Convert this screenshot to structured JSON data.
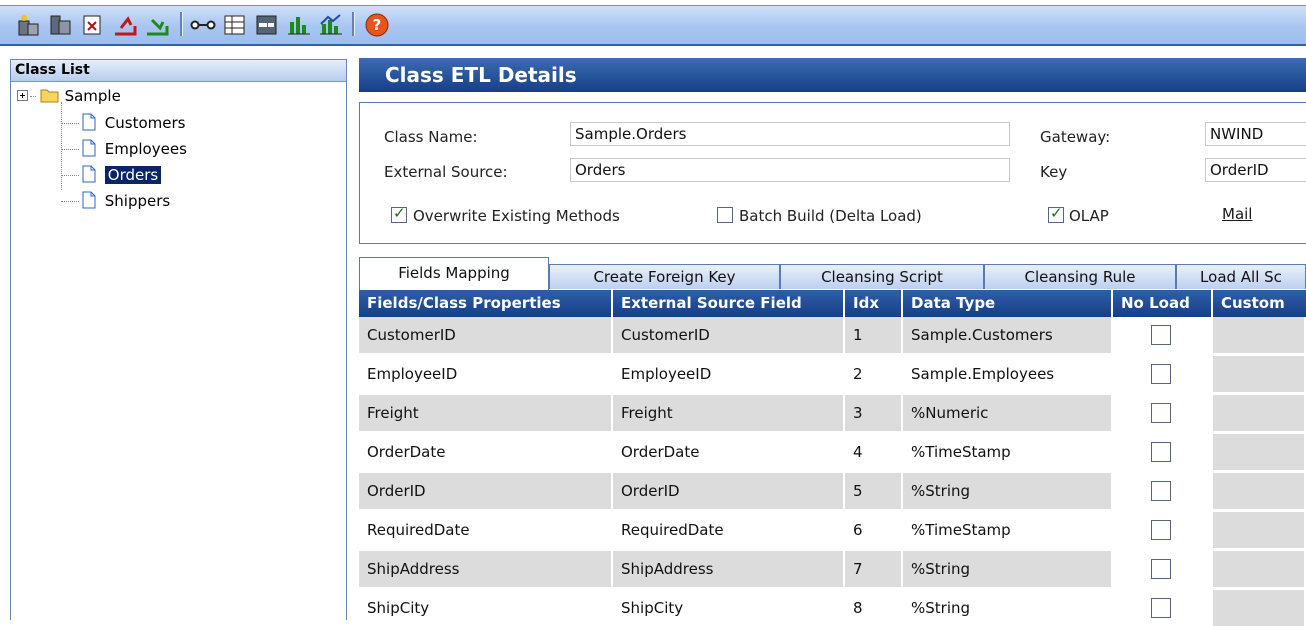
{
  "toolbar": {
    "icons": [
      "new-class-icon",
      "database-icon",
      "import-icon",
      "export-icon",
      "load-icon",
      "relation-icon",
      "table-icon",
      "table-edit-icon",
      "bar-chart-icon",
      "chart-icon",
      "help-icon"
    ]
  },
  "class_list": {
    "title": "Class List",
    "root": "Sample",
    "items": [
      "Customers",
      "Employees",
      "Orders",
      "Shippers"
    ],
    "selected": "Orders"
  },
  "details": {
    "title": "Class ETL Details",
    "class_name_label": "Class Name:",
    "class_name_value": "Sample.Orders",
    "external_source_label": "External Source:",
    "external_source_value": "Orders",
    "gateway_label": "Gateway:",
    "gateway_value": "NWIND",
    "key_label": "Key",
    "key_value": "OrderID",
    "overwrite_label": "Overwrite Existing Methods",
    "overwrite_checked": true,
    "batch_label": "Batch Build (Delta Load)",
    "batch_checked": false,
    "olap_label": "OLAP",
    "olap_checked": true,
    "mail_label": "Mail"
  },
  "tabs": [
    "Fields Mapping",
    "Create Foreign Key",
    "Cleansing Script",
    "Cleansing Rule",
    "Load All Sc"
  ],
  "active_tab": "Fields Mapping",
  "grid": {
    "columns": [
      "Fields/Class Properties",
      "External Source Field",
      "Idx",
      "Data Type",
      "No Load",
      "Custom"
    ],
    "rows": [
      {
        "field": "CustomerID",
        "source": "CustomerID",
        "idx": "1",
        "type": "Sample.Customers",
        "no_load": false
      },
      {
        "field": "EmployeeID",
        "source": "EmployeeID",
        "idx": "2",
        "type": "Sample.Employees",
        "no_load": false
      },
      {
        "field": "Freight",
        "source": "Freight",
        "idx": "3",
        "type": "%Numeric",
        "no_load": false
      },
      {
        "field": "OrderDate",
        "source": "OrderDate",
        "idx": "4",
        "type": "%TimeStamp",
        "no_load": false
      },
      {
        "field": "OrderID",
        "source": "OrderID",
        "idx": "5",
        "type": "%String",
        "no_load": false
      },
      {
        "field": "RequiredDate",
        "source": "RequiredDate",
        "idx": "6",
        "type": "%TimeStamp",
        "no_load": false
      },
      {
        "field": "ShipAddress",
        "source": "ShipAddress",
        "idx": "7",
        "type": "%String",
        "no_load": false
      },
      {
        "field": "ShipCity",
        "source": "ShipCity",
        "idx": "8",
        "type": "%String",
        "no_load": false
      }
    ]
  },
  "colors": {
    "header_blue": "#163f87",
    "selected": "#0a246a",
    "row_shade": "#dcdcdc"
  }
}
